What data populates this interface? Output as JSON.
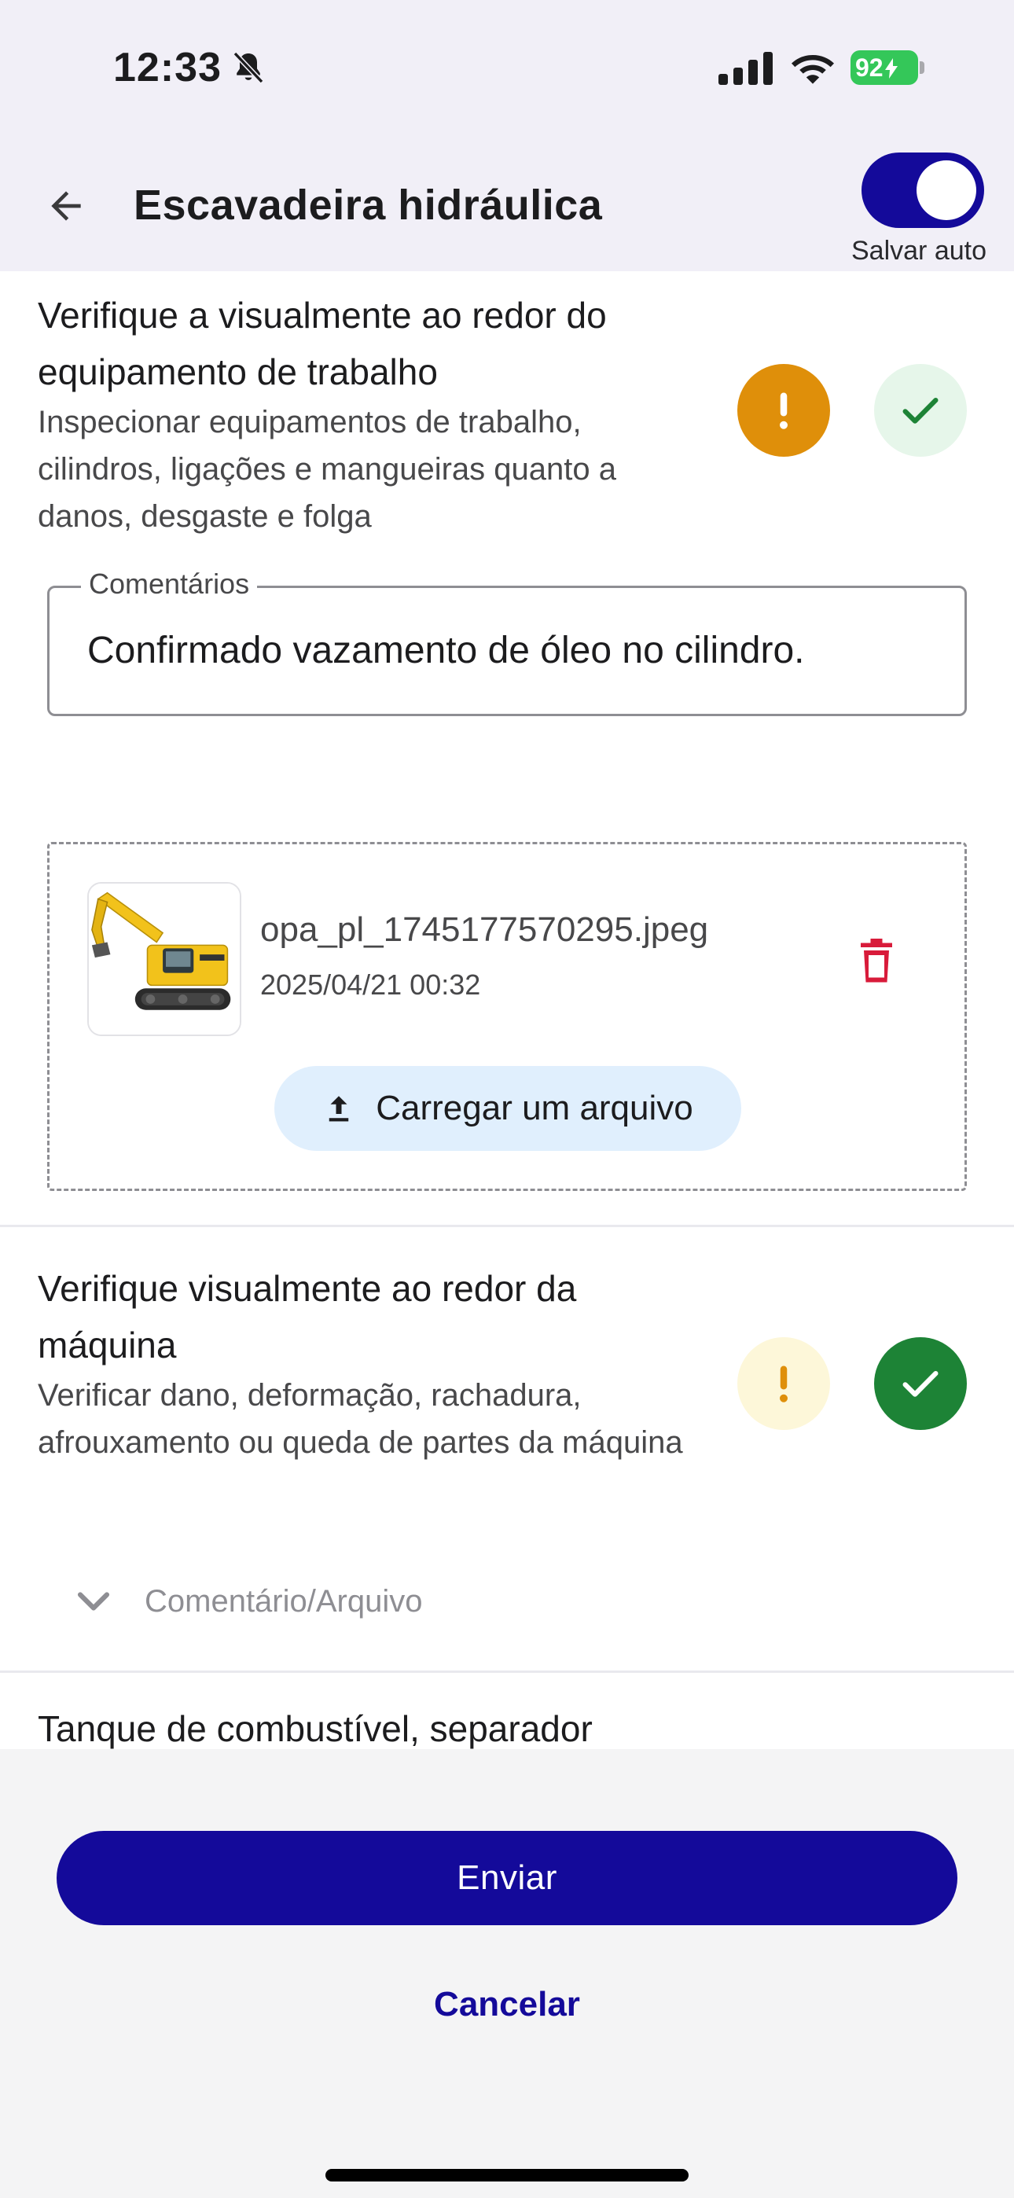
{
  "status_bar": {
    "time": "12:33",
    "battery": "92",
    "icons": [
      "bell-off-icon",
      "signal-icon",
      "wifi-icon",
      "battery-charging-icon"
    ]
  },
  "app_bar": {
    "title": "Escavadeira hidráulica",
    "back_icon": "arrow-left-icon",
    "auto_save_label": "Salvar auto",
    "auto_save_on": true
  },
  "items": [
    {
      "title": "Verifique a visualmente ao redor do equipamento de trabalho",
      "description": "Inspecionar equipamentos de trabalho, cilindros, ligações e mangueiras quanto a danos, desgaste e folga",
      "status": "warning",
      "comment_label": "Comentários",
      "comment_value": "Confirmado vazamento de óleo no cilindro.",
      "attachment": {
        "file_name": "opa_pl_1745177570295.jpeg",
        "date": "2025/04/21 00:32"
      },
      "upload_label": "Carregar um arquivo"
    },
    {
      "title": "Verifique visualmente ao redor da máquina",
      "description": "Verificar dano, deformação, rachadura, afrouxamento ou queda de partes da máquina",
      "status": "ok",
      "expand_label": "Comentário/Arquivo"
    },
    {
      "title": "Tanque de combustível, separador"
    }
  ],
  "actions": {
    "submit_label": "Enviar",
    "cancel_label": "Cancelar"
  },
  "colors": {
    "primary": "#140a9a",
    "warning": "#df8f0a",
    "ok": "#1d8336",
    "delete": "#d81b3a"
  }
}
